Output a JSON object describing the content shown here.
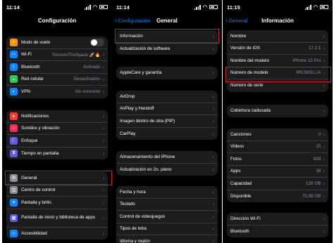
{
  "phone1": {
    "time": "11:14",
    "title": "Configuración",
    "group1": [
      {
        "label": "Modo de vuelo",
        "value": "",
        "icon": "airplane-icon",
        "color": "#ff9500",
        "glyph": "✈",
        "toggle": true
      },
      {
        "label": "Wi-Fi",
        "value": "TorresInTheSpace 🚀🔥",
        "icon": "wifi-icon",
        "color": "#0a84ff",
        "glyph": "◠"
      },
      {
        "label": "Bluetooth",
        "value": "Activado",
        "icon": "bluetooth-icon",
        "color": "#0a84ff",
        "glyph": "ᛒ"
      },
      {
        "label": "Red celular",
        "value": "Desactivados",
        "icon": "cellular-icon",
        "color": "#34c759",
        "glyph": "⌁"
      },
      {
        "label": "VPN",
        "value": "Sin conexión",
        "icon": "vpn-icon",
        "color": "#0a84ff",
        "glyph": "◐"
      }
    ],
    "group2": [
      {
        "label": "Notificaciones",
        "icon": "bell-icon",
        "color": "#ff3b30",
        "glyph": "●"
      },
      {
        "label": "Sonidos y vibración",
        "icon": "speaker-icon",
        "color": "#ff2d55",
        "glyph": "♪"
      },
      {
        "label": "Enfoque",
        "icon": "moon-icon",
        "color": "#5e5ce6",
        "glyph": "☾"
      },
      {
        "label": "Tiempo en pantalla",
        "icon": "hourglass-icon",
        "color": "#5e5ce6",
        "glyph": "⧗"
      }
    ],
    "group3": [
      {
        "label": "General",
        "icon": "gear-icon",
        "color": "#8e8e93",
        "glyph": "⚙"
      },
      {
        "label": "Centro de control",
        "icon": "switches-icon",
        "color": "#8e8e93",
        "glyph": "☰"
      },
      {
        "label": "Pantalla y brillo",
        "icon": "brightness-icon",
        "color": "#0a84ff",
        "glyph": "☀"
      },
      {
        "label": "Pantalla de inicio y biblioteca de apps",
        "icon": "home-grid-icon",
        "color": "#5e5ce6",
        "glyph": "▦"
      },
      {
        "label": "Accesibilidad",
        "icon": "accessibility-icon",
        "color": "#0a84ff",
        "glyph": "☺"
      }
    ]
  },
  "phone2": {
    "time": "11:14",
    "back": "Configuración",
    "title": "General",
    "group1": [
      "Información",
      "Actualización de software"
    ],
    "group2": [
      "AppleCare y garantía"
    ],
    "group3": [
      "AirDrop",
      "AirPlay y Handoff",
      "Imagen dentro de otra (PIP)",
      "CarPlay"
    ],
    "group4": [
      "Almacenamiento del iPhone",
      "Actualización en 2o. plano"
    ],
    "group5": [
      "Fecha y hora",
      "Teclado",
      "Control de videojuegos",
      "Tipos de letra",
      "Idioma y región"
    ]
  },
  "phone3": {
    "time": "11:15",
    "back": "General",
    "title": "Información",
    "group1": [
      {
        "label": "Nombre",
        "value": ""
      },
      {
        "label": "Versión de iOS",
        "value": "17.2.1"
      },
      {
        "label": "Nombre del modelo",
        "value": "iPhone 12 Pro"
      },
      {
        "label": "Número de modelo",
        "value": "MGJM3LL/A"
      },
      {
        "label": "Número de serie",
        "value": ""
      }
    ],
    "group2": [
      {
        "label": "Cobertura caducada",
        "value": ""
      }
    ],
    "group3": [
      {
        "label": "Canciones",
        "value": "0"
      },
      {
        "label": "Videos",
        "value": "15"
      },
      {
        "label": "Fotos",
        "value": "928"
      },
      {
        "label": "Apps",
        "value": "38"
      },
      {
        "label": "Capacidad",
        "value": "128 GB"
      },
      {
        "label": "Disponible",
        "value": "75,98 GB"
      }
    ],
    "group4": [
      {
        "label": "Dirección Wi-Fi",
        "value": ""
      },
      {
        "label": "Bluetooth",
        "value": ""
      }
    ]
  }
}
